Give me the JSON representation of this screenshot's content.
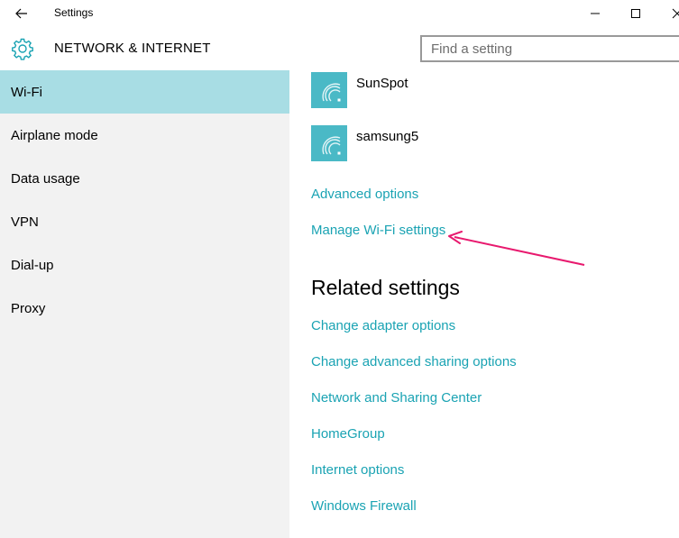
{
  "window": {
    "title": "Settings"
  },
  "header": {
    "title": "NETWORK & INTERNET",
    "search_placeholder": "Find a setting"
  },
  "sidebar": {
    "items": [
      {
        "label": "Wi-Fi",
        "selected": true
      },
      {
        "label": "Airplane mode",
        "selected": false
      },
      {
        "label": "Data usage",
        "selected": false
      },
      {
        "label": "VPN",
        "selected": false
      },
      {
        "label": "Dial-up",
        "selected": false
      },
      {
        "label": "Proxy",
        "selected": false
      }
    ]
  },
  "content": {
    "networks": [
      {
        "name": "SunSpot",
        "icon": "wifi-icon"
      },
      {
        "name": "samsung5",
        "icon": "wifi-icon"
      }
    ],
    "advanced_options": "Advanced options",
    "manage_wifi": "Manage Wi-Fi settings",
    "related_title": "Related settings",
    "related_links": [
      "Change adapter options",
      "Change advanced sharing options",
      "Network and Sharing Center",
      "HomeGroup",
      "Internet options",
      "Windows Firewall"
    ]
  },
  "colors": {
    "accent": "#1aa3b3",
    "selected_bg": "#a8dde4",
    "tile_bg": "#4ab9c6",
    "sidebar_bg": "#f2f2f2",
    "annotation_arrow": "#e8196e"
  }
}
